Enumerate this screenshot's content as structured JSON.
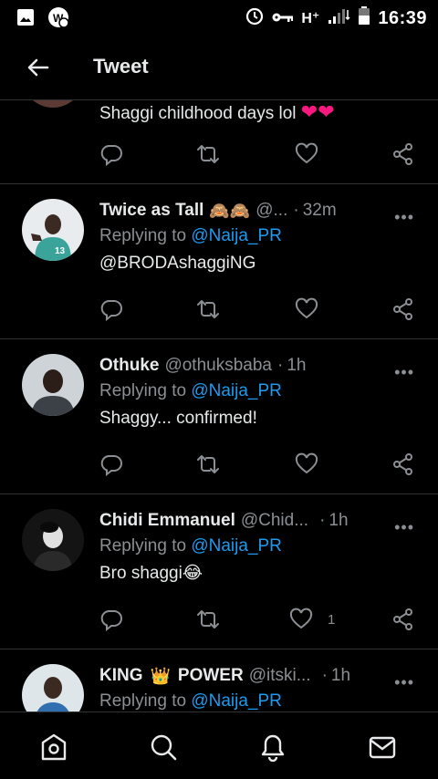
{
  "status_bar": {
    "time": "16:39",
    "network": "H⁺",
    "icons": [
      "image-icon",
      "app-notification-icon",
      "alarm-icon",
      "key-icon",
      "signal-icon",
      "battery-icon"
    ]
  },
  "header": {
    "title": "Tweet",
    "back_icon": "arrow-left-icon"
  },
  "tweets": [
    {
      "text": "Shaggi childhood days lol",
      "emoji": "❤❤",
      "actions": {
        "reply": "",
        "retweet": "",
        "like": "",
        "share": ""
      }
    },
    {
      "name": "Twice as Tall",
      "name_emoji": "🙈🙈",
      "handle": "@...",
      "time": "32m",
      "replying_prefix": "Replying to",
      "replying_to": "@Naija_PR",
      "text_link": "@BRODAshaggiNG",
      "avatar_color": "#3a8f86"
    },
    {
      "name": "Othuke",
      "handle": "@othuksbaba",
      "time": "1h",
      "replying_prefix": "Replying to",
      "replying_to": "@Naija_PR",
      "text": "Shaggy... confirmed!",
      "avatar_color": "#c9cfd2"
    },
    {
      "name": "Chidi Emmanuel",
      "handle": "@Chid...",
      "time": "1h",
      "replying_prefix": "Replying to",
      "replying_to": "@Naija_PR",
      "text": "Bro shaggi",
      "text_emoji": "😂",
      "like_count": "1",
      "avatar_color": "#1a1a1a"
    },
    {
      "name": "KING",
      "name_emoji": "👑",
      "name_suffix": "POWER",
      "handle": "@itski...",
      "time": "1h",
      "replying_prefix": "Replying to",
      "replying_to": "@Naija_PR",
      "avatar_color": "#8aa6c4"
    }
  ],
  "bottom_nav": [
    "home-icon",
    "search-icon",
    "notifications-icon",
    "messages-icon"
  ],
  "colors": {
    "accent": "#1d9bf0",
    "background": "#000000",
    "secondary_text": "#8b8f93",
    "heart": "#f91880"
  }
}
